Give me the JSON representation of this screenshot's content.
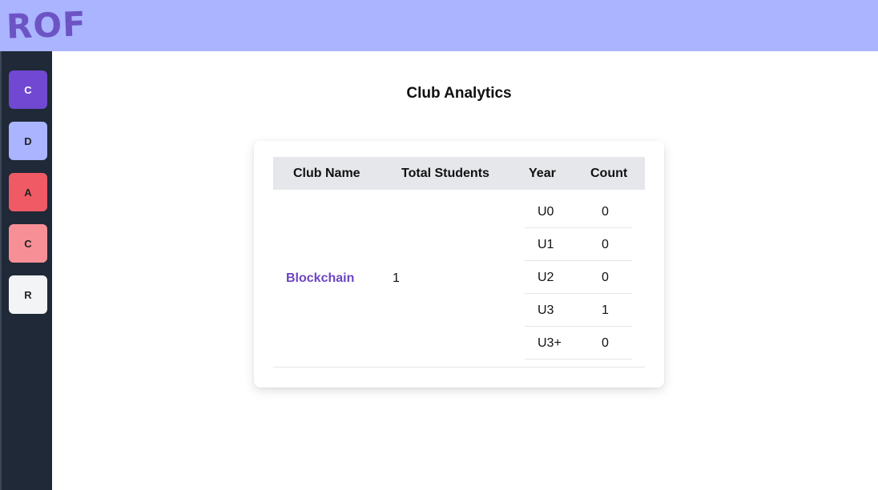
{
  "app": {
    "logo_text": "ROF"
  },
  "sidebar": {
    "items": [
      {
        "label": "C",
        "color": "#7048d1",
        "text_color": "#ffffff"
      },
      {
        "label": "D",
        "color": "#aab4ff",
        "text_color": "#222222"
      },
      {
        "label": "A",
        "color": "#f05a64",
        "text_color": "#222222"
      },
      {
        "label": "C",
        "color": "#f79096",
        "text_color": "#222222"
      },
      {
        "label": "R",
        "color": "#f3f4f6",
        "text_color": "#222222"
      }
    ]
  },
  "main": {
    "title": "Club Analytics",
    "table": {
      "headers": [
        "Club Name",
        "Total Students",
        "Year",
        "Count"
      ],
      "rows": [
        {
          "club_name": "Blockchain",
          "total_students": "1",
          "years": [
            {
              "year": "U0",
              "count": "0"
            },
            {
              "year": "U1",
              "count": "0"
            },
            {
              "year": "U2",
              "count": "0"
            },
            {
              "year": "U3",
              "count": "1"
            },
            {
              "year": "U3+",
              "count": "0"
            }
          ]
        }
      ]
    }
  },
  "colors": {
    "topbar": "#aab4ff",
    "sidebar": "#1f2937",
    "accent": "#6d45c2"
  }
}
